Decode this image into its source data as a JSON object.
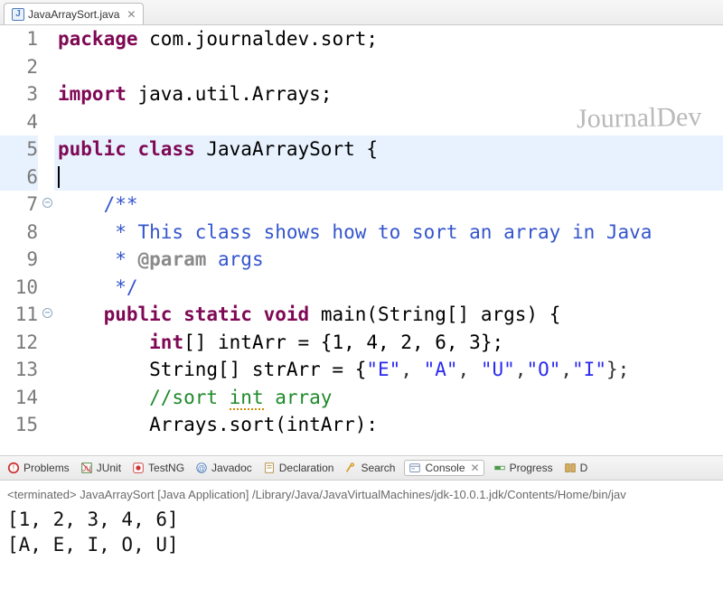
{
  "editor_tab": {
    "label": "JavaArraySort.java",
    "close_glyph": "✕"
  },
  "watermark": "JournalDev",
  "gutter": [
    "1",
    "2",
    "3",
    "4",
    "5",
    "6",
    "7",
    "8",
    "9",
    "10",
    "11",
    "12",
    "13",
    "14",
    "15"
  ],
  "code": {
    "l1_kw": "package",
    "l1_pkg": " com.journaldev.sort;",
    "l3_kw": "import",
    "l3_pkg": " java.util.Arrays;",
    "l5_kw1": "public",
    "l5_kw2": "class",
    "l5_name": " JavaArraySort {",
    "l7": "    /**",
    "l8": "     * This class shows how to sort an array in Java",
    "l9a": "     * ",
    "l9_tag": "@param",
    "l9b": " args",
    "l10": "     */",
    "l11_kw1": "public",
    "l11_kw2": "static",
    "l11_kw3": "void",
    "l11_rest": " main(String[] args) {",
    "l12_kw": "int",
    "l12_rest": "[] intArr = {1, 4, 2, 6, 3};",
    "l13_a": "        String[] strArr = {",
    "l13_s1": "\"E\"",
    "l13_c1": ", ",
    "l13_s2": "\"A\"",
    "l13_c2": ", ",
    "l13_s3": "\"U\"",
    "l13_c3": ",",
    "l13_s4": "\"O\"",
    "l13_c4": ",",
    "l13_s5": "\"I\"",
    "l13_b": "};",
    "l14_a": "        //sort ",
    "l14_squig": "int",
    "l14_b": " array",
    "l15": "        Arrays.sort(intArr):"
  },
  "views": {
    "problems": "Problems",
    "junit": "JUnit",
    "testng": "TestNG",
    "javadoc": "Javadoc",
    "declaration": "Declaration",
    "search": "Search",
    "console": "Console",
    "console_close": "✕",
    "progress": "Progress",
    "last_partial": "D"
  },
  "console": {
    "status": "<terminated> JavaArraySort [Java Application] /Library/Java/JavaVirtualMachines/jdk-10.0.1.jdk/Contents/Home/bin/jav",
    "line1": "[1, 2, 3, 4, 6]",
    "line2": "[A, E, I, O, U]"
  }
}
